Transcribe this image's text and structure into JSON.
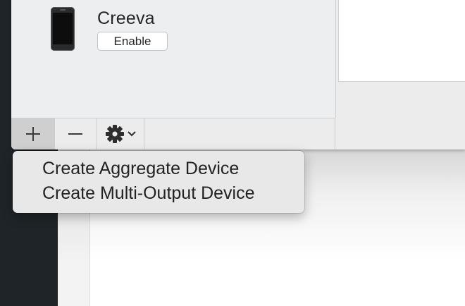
{
  "device": {
    "name": "Creeva",
    "enable_label": "Enable",
    "icon": "iphone-icon"
  },
  "toolbar": {
    "add_symbol": "+",
    "remove_symbol": "—",
    "add_icon": "plus-icon",
    "remove_icon": "minus-icon",
    "gear_icon": "gear-icon",
    "chevron_icon": "chevron-down-icon"
  },
  "menu": {
    "items": [
      {
        "label": "Create Aggregate Device"
      },
      {
        "label": "Create Multi-Output Device"
      }
    ]
  },
  "colors": {
    "sidebar_dark": "#1f2428",
    "window_bg": "#ececec",
    "pressed_button": "#cfcfcf",
    "menu_bg": "#e8e8e8"
  }
}
